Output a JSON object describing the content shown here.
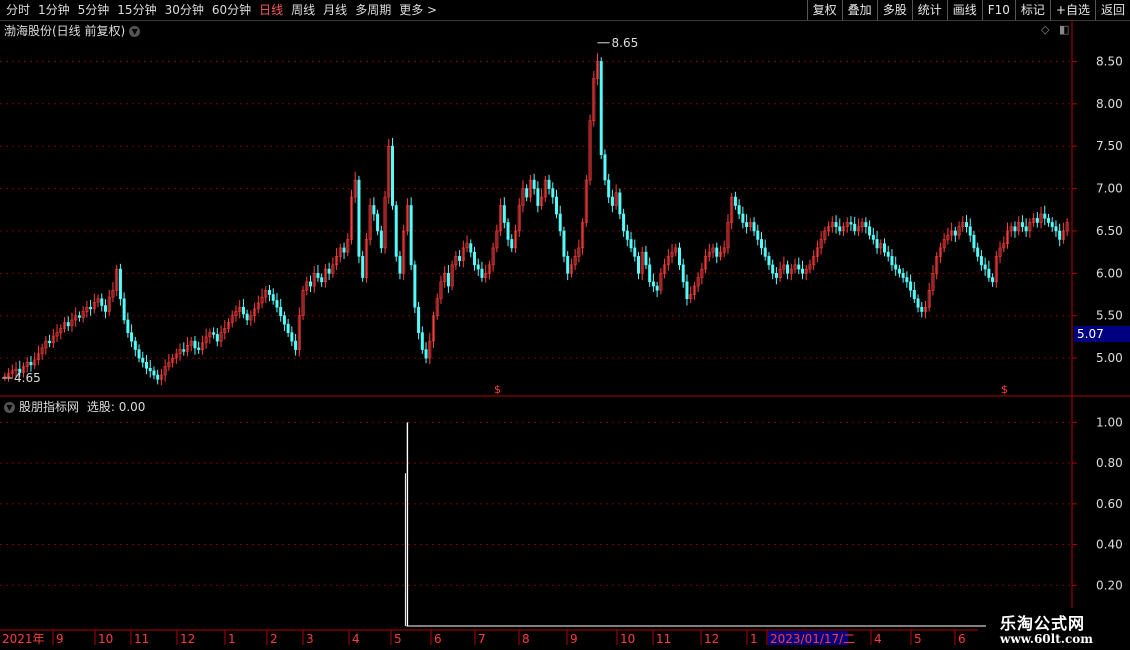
{
  "toolbar": {
    "periods": [
      "分时",
      "1分钟",
      "5分钟",
      "15分钟",
      "30分钟",
      "60分钟",
      "日线",
      "周线",
      "月线",
      "多周期",
      "更多 >"
    ],
    "active_period": "日线",
    "buttons": [
      "复权",
      "叠加",
      "多股",
      "统计",
      "画线",
      "F10",
      "标记",
      "+自选",
      "返回"
    ]
  },
  "main_pane": {
    "title": "渤海股份(日线 前复权)",
    "y_ticks": [
      "8.50",
      "8.00",
      "7.50",
      "7.00",
      "6.50",
      "6.00",
      "5.50",
      "5.00"
    ],
    "current_price": "5.07",
    "high_label": "8.65",
    "low_label": "4.65",
    "signal_marker": "$"
  },
  "indicator_pane": {
    "title": "股朋指标网",
    "value_label": "选股: 0.00",
    "y_ticks": [
      "1.00",
      "0.80",
      "0.60",
      "0.40",
      "0.20"
    ]
  },
  "x_axis": {
    "labels": [
      "2021年",
      "9",
      "10",
      "11",
      "12",
      "1",
      "2",
      "3",
      "4",
      "5",
      "6",
      "7",
      "8",
      "9",
      "10",
      "11",
      "12",
      "1",
      "2023/01/17/二",
      "4",
      "5",
      "6"
    ]
  },
  "watermark": {
    "line1": "乐淘公式网",
    "line2": "www.60lt.com"
  },
  "colors": {
    "up": "#ff3c3c",
    "down": "#54fcfc",
    "grid": "#7a0000",
    "axis": "#b40000",
    "text": "#dcdcdc",
    "highlight": "#000080"
  },
  "chart_data": {
    "type": "candlestick",
    "ylim": [
      4.6,
      8.8
    ],
    "closes": [
      4.78,
      4.82,
      4.85,
      4.87,
      4.83,
      4.9,
      4.95,
      4.92,
      4.98,
      5.05,
      5.12,
      5.2,
      5.18,
      5.26,
      5.3,
      5.35,
      5.42,
      5.38,
      5.45,
      5.5,
      5.48,
      5.55,
      5.6,
      5.58,
      5.66,
      5.7,
      5.62,
      5.55,
      5.72,
      5.8,
      6.05,
      5.7,
      5.45,
      5.3,
      5.2,
      5.1,
      5.0,
      4.95,
      4.88,
      4.85,
      4.8,
      4.75,
      4.8,
      4.9,
      4.95,
      5.0,
      5.05,
      5.1,
      5.08,
      5.15,
      5.2,
      5.12,
      5.1,
      5.18,
      5.25,
      5.3,
      5.28,
      5.2,
      5.3,
      5.35,
      5.42,
      5.5,
      5.55,
      5.6,
      5.52,
      5.45,
      5.5,
      5.58,
      5.65,
      5.72,
      5.8,
      5.75,
      5.68,
      5.6,
      5.5,
      5.4,
      5.3,
      5.2,
      5.1,
      5.5,
      5.8,
      5.9,
      5.85,
      6.0,
      5.95,
      5.9,
      6.05,
      6.0,
      6.1,
      6.2,
      6.3,
      6.25,
      6.4,
      6.9,
      7.1,
      6.2,
      5.95,
      6.4,
      6.8,
      6.7,
      6.5,
      6.3,
      6.9,
      7.5,
      6.8,
      6.2,
      6.0,
      6.5,
      6.8,
      6.1,
      5.6,
      5.3,
      5.1,
      5.0,
      5.2,
      5.5,
      5.7,
      5.9,
      6.0,
      5.85,
      6.1,
      6.2,
      6.15,
      6.3,
      6.35,
      6.25,
      6.1,
      6.05,
      5.95,
      6.0,
      6.1,
      6.3,
      6.5,
      6.8,
      6.6,
      6.4,
      6.3,
      6.5,
      6.8,
      7.0,
      6.9,
      7.1,
      7.0,
      6.8,
      6.9,
      7.1,
      7.0,
      6.9,
      6.7,
      6.5,
      6.2,
      6.0,
      6.1,
      6.2,
      6.3,
      6.6,
      7.1,
      7.8,
      8.3,
      8.5,
      7.4,
      7.1,
      6.9,
      6.8,
      6.95,
      6.7,
      6.5,
      6.4,
      6.3,
      6.2,
      6.0,
      6.25,
      6.1,
      5.9,
      5.85,
      5.8,
      6.0,
      6.1,
      6.2,
      6.25,
      6.3,
      6.1,
      5.9,
      5.7,
      5.75,
      5.85,
      5.95,
      6.05,
      6.2,
      6.25,
      6.3,
      6.2,
      6.25,
      6.3,
      6.6,
      6.9,
      6.8,
      6.7,
      6.6,
      6.55,
      6.6,
      6.5,
      6.4,
      6.3,
      6.2,
      6.1,
      6.0,
      5.95,
      6.05,
      6.1,
      6.0,
      6.05,
      6.1,
      6.05,
      6.0,
      6.05,
      6.1,
      6.2,
      6.3,
      6.4,
      6.5,
      6.55,
      6.6,
      6.55,
      6.5,
      6.55,
      6.6,
      6.58,
      6.5,
      6.55,
      6.6,
      6.55,
      6.45,
      6.4,
      6.3,
      6.35,
      6.25,
      6.2,
      6.1,
      6.05,
      6.0,
      5.95,
      5.9,
      5.8,
      5.7,
      5.6,
      5.55,
      5.6,
      5.8,
      6.0,
      6.2,
      6.3,
      6.4,
      6.45,
      6.5,
      6.45,
      6.55,
      6.6,
      6.55,
      6.45,
      6.3,
      6.2,
      6.1,
      6.05,
      5.95,
      5.9,
      6.2,
      6.3,
      6.35,
      6.5,
      6.55,
      6.5,
      6.6,
      6.55,
      6.5,
      6.6,
      6.65,
      6.6,
      6.7,
      6.65,
      6.6,
      6.55,
      6.5,
      6.4,
      6.5,
      6.6
    ],
    "indicator": {
      "type": "bar",
      "spike_index": 108,
      "spike_value": 1.0,
      "ylim": [
        0,
        1.1
      ]
    }
  }
}
